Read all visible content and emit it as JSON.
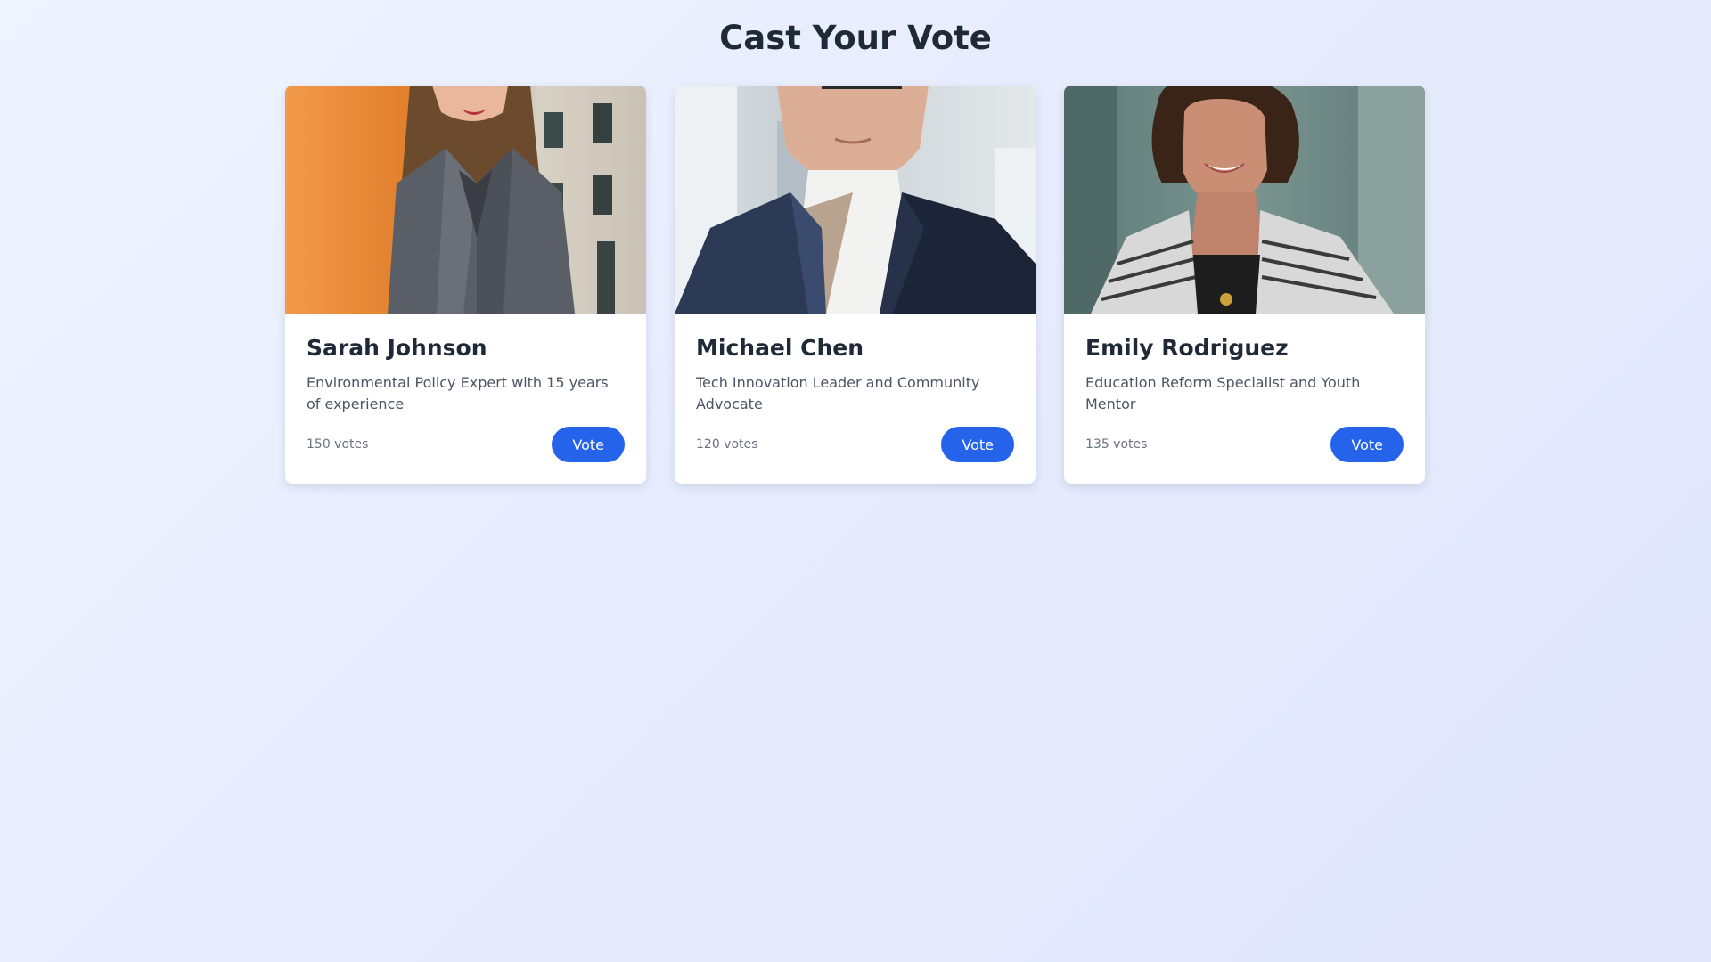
{
  "page": {
    "title": "Cast Your Vote"
  },
  "candidates": [
    {
      "name": "Sarah Johnson",
      "description": "Environmental Policy Expert with 15 years of experience",
      "votes": "150 votes",
      "vote_label": "Vote",
      "photo": "portrait-woman-gray-blazer-orange-wall"
    },
    {
      "name": "Michael Chen",
      "description": "Tech Innovation Leader and Community Advocate",
      "votes": "120 votes",
      "vote_label": "Vote",
      "photo": "portrait-man-navy-blazer-office"
    },
    {
      "name": "Emily Rodriguez",
      "description": "Education Reform Specialist and Youth Mentor",
      "votes": "135 votes",
      "vote_label": "Vote",
      "photo": "portrait-woman-curly-hair-striped-cardigan"
    }
  ],
  "colors": {
    "accent": "#2563eb",
    "heading": "#1f2937",
    "muted": "#6b7280",
    "body_text": "#4b5563"
  }
}
